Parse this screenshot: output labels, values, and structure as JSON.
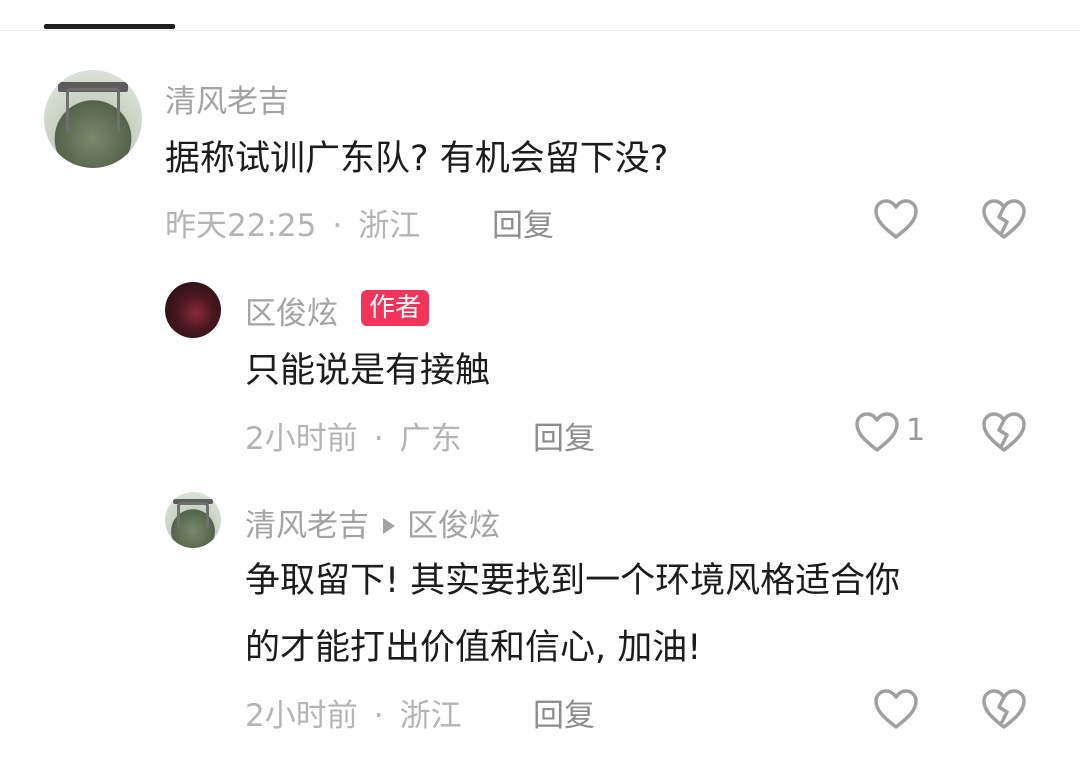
{
  "comments": [
    {
      "username": "清风老吉",
      "text": "据称试训广东队? 有机会留下没?",
      "time": "昨天22:25",
      "location": "浙江",
      "reply_label": "回复"
    },
    {
      "username": "区俊炫",
      "badge": "作者",
      "text": "只能说是有接触",
      "time": "2小时前",
      "location": "广东",
      "reply_label": "回复",
      "like_count": "1"
    },
    {
      "username": "清风老吉",
      "reply_to": "区俊炫",
      "text_line1": "争取留下! 其实要找到一个环境风格适合你",
      "text_line2": "的才能打出价值和信心, 加油!",
      "time": "2小时前",
      "location": "浙江",
      "reply_label": "回复"
    }
  ],
  "icons": {
    "like": "heart-outline-icon",
    "dislike": "broken-heart-icon",
    "reply_indicator": "play-arrow-icon"
  },
  "colors": {
    "badge": "#f0345a",
    "meta_text": "#b4b4b4",
    "username_text": "#a3a3a3"
  }
}
